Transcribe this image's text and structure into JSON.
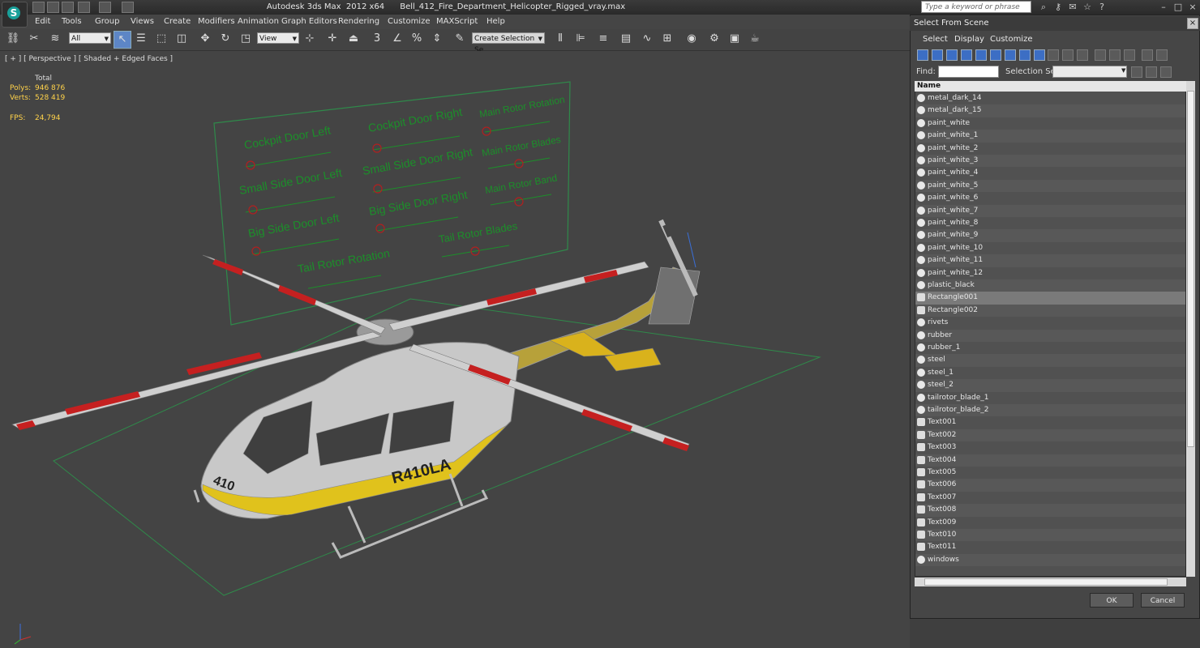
{
  "window": {
    "title": "Autodesk 3ds Max  2012 x64      Bell_412_Fire_Department_Helicopter_Rigged_vray.max",
    "search_placeholder": "Type a keyword or phrase"
  },
  "menu": [
    "Edit",
    "Tools",
    "Group",
    "Views",
    "Create",
    "Modifiers",
    "Animation",
    "Graph Editors",
    "Rendering",
    "Customize",
    "MAXScript",
    "Help"
  ],
  "toolbar": {
    "selection_filter": "All",
    "reference_coord": "View",
    "named_selection_set": "Create Selection Se"
  },
  "viewport": {
    "label": "[ + ] [ Perspective ] [ Shaded + Edged Faces ]",
    "stats": {
      "header": "Total",
      "polys_label": "Polys:",
      "polys_value": "946 876",
      "verts_label": "Verts:",
      "verts_value": "528 419",
      "fps_label": "FPS:",
      "fps_value": "24,794"
    },
    "control_panel_labels": [
      "Cockpit Door Left",
      "Cockpit Door Right",
      "Main Rotor Rotation",
      "Small Side Door Left",
      "Small Side Door Right",
      "Main Rotor Blades",
      "Big Side Door Left",
      "Big Side Door Right",
      "Main Rotor Band",
      "Tail Rotor Rotation",
      "Tail Rotor Blades"
    ],
    "fuselage_text": "R410LA",
    "nose_text": "410"
  },
  "dialog": {
    "title": "Select From Scene",
    "menu": [
      "Select",
      "Display",
      "Customize"
    ],
    "find_label": "Find:",
    "selection_set_label": "Selection Set:",
    "list_header": "Name",
    "items": [
      "metal_dark_14",
      "metal_dark_15",
      "paint_white",
      "paint_white_1",
      "paint_white_2",
      "paint_white_3",
      "paint_white_4",
      "paint_white_5",
      "paint_white_6",
      "paint_white_7",
      "paint_white_8",
      "paint_white_9",
      "paint_white_10",
      "paint_white_11",
      "paint_white_12",
      "plastic_black",
      "Rectangle001",
      "Rectangle002",
      "rivets",
      "rubber",
      "rubber_1",
      "steel",
      "steel_1",
      "steel_2",
      "tailrotor_blade_1",
      "tailrotor_blade_2",
      "Text001",
      "Text002",
      "Text003",
      "Text004",
      "Text005",
      "Text006",
      "Text007",
      "Text008",
      "Text009",
      "Text010",
      "Text011",
      "windows"
    ],
    "selected_item": "Rectangle001",
    "ok_label": "OK",
    "cancel_label": "Cancel"
  }
}
